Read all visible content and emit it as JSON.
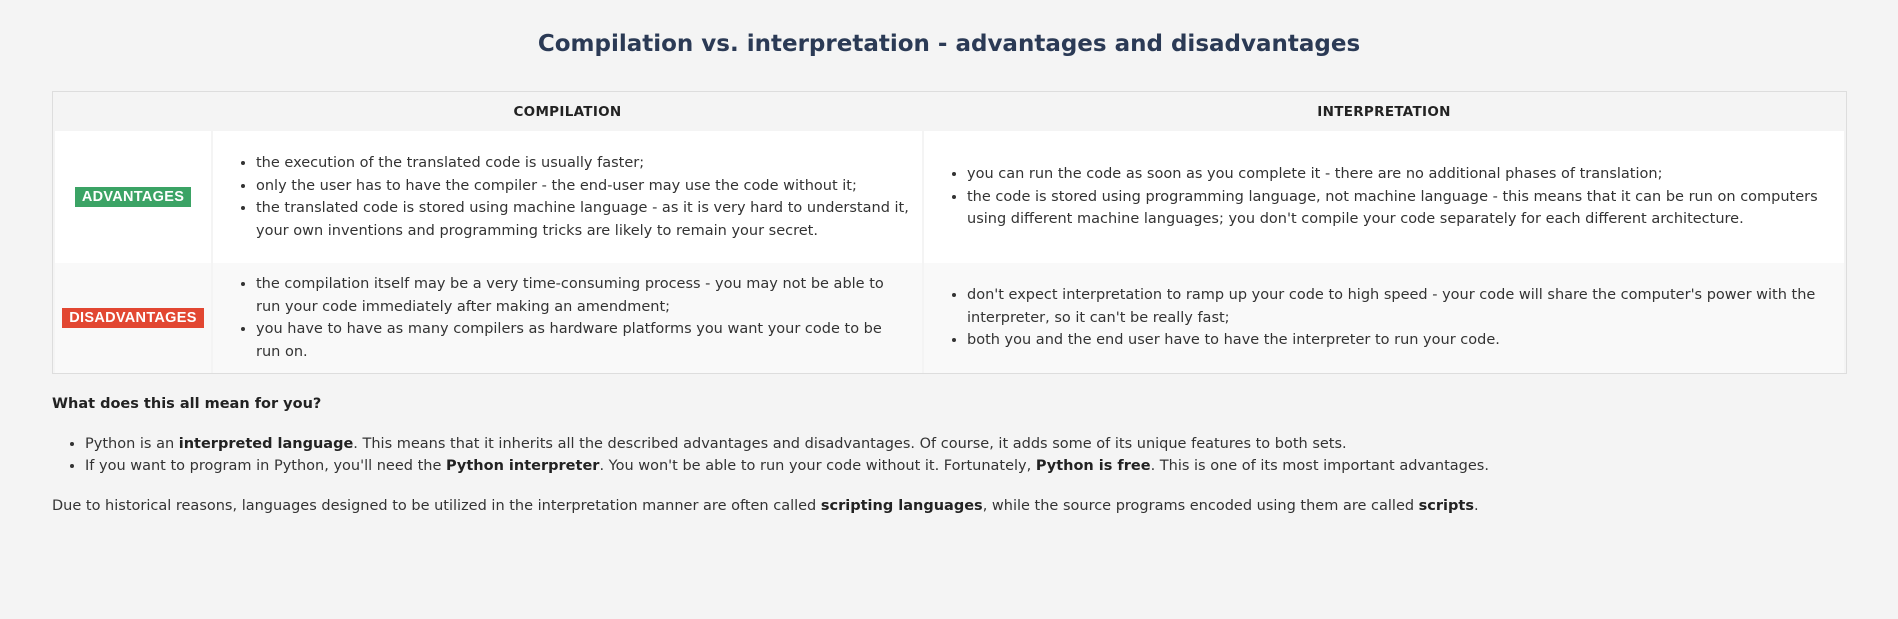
{
  "title": "Compilation vs. interpretation - advantages and disadvantages",
  "table": {
    "headers": [
      "",
      "COMPILATION",
      "INTERPRETATION"
    ],
    "rows": [
      {
        "label": "ADVANTAGES",
        "compilation": [
          "the execution of the translated code is usually faster;",
          "only the user has to have the compiler - the end-user may use the code without it;",
          "the translated code is stored using machine language - as it is very hard to understand it, your own inventions and programming tricks are likely to remain your secret."
        ],
        "interpretation": [
          "you can run the code as soon as you complete it - there are no additional phases of translation;",
          "the code is stored using programming language, not machine language - this means that it can be run on computers using different machine languages; you don't compile your code separately for each different architecture."
        ]
      },
      {
        "label": "DISADVANTAGES",
        "compilation": [
          "the compilation itself may be a very time-consuming process - you may not be able to run your code immediately after making an amendment;",
          "you have to have as many compilers as hardware platforms you want your code to be run on."
        ],
        "interpretation": [
          "don't expect interpretation to ramp up your code to high speed - your code will share the computer's power with the interpreter, so it can't be really fast;",
          "both you and the end user have to have the interpreter to run your code."
        ]
      }
    ]
  },
  "section_title": "What does this all mean for you?",
  "points": [
    {
      "p1": "Python is an ",
      "b1": "interpreted language",
      "p2": ". This means that it inherits all the described advantages and disadvantages. Of course, it adds some of its unique features to both sets."
    },
    {
      "p1": "If you want to program in Python, you'll need the ",
      "b1": "Python interpreter",
      "p2": ". You won't be able to run your code without it. Fortunately, ",
      "b2": "Python is free",
      "p3": ". This is one of its most important advantages."
    }
  ],
  "footer": {
    "p1": "Due to historical reasons, languages designed to be utilized in the interpretation manner are often called ",
    "b1": "scripting languages",
    "p2": ", while the source programs encoded using them are called ",
    "b2": "scripts",
    "p3": "."
  },
  "colors": {
    "advantages_badge": "#3ba365",
    "disadvantages_badge": "#e24732",
    "title": "#2b3a55"
  }
}
